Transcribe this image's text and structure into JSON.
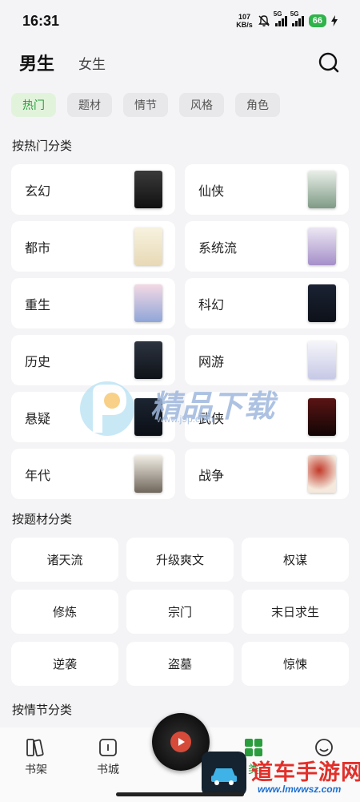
{
  "status": {
    "time": "16:31",
    "net_speed_value": "107",
    "net_speed_unit": "KB/s",
    "sig1_label": "5G",
    "sig2_label": "5G",
    "battery": "66"
  },
  "header": {
    "tab_male": "男生",
    "tab_female": "女生",
    "icons": [
      "search-icon"
    ]
  },
  "filters": [
    "热门",
    "题材",
    "情节",
    "风格",
    "角色"
  ],
  "section_hot": "按热门分类",
  "genres": [
    "玄幻",
    "仙侠",
    "都市",
    "系统流",
    "重生",
    "科幻",
    "历史",
    "网游",
    "悬疑",
    "武侠",
    "年代",
    "战争"
  ],
  "section_theme": "按题材分类",
  "themes": [
    "诸天流",
    "升级爽文",
    "权谋",
    "修炼",
    "宗门",
    "末日求生",
    "逆袭",
    "盗墓",
    "惊悚"
  ],
  "section_plot": "按情节分类",
  "nav": {
    "bookshelf": "书架",
    "bookcity": "书城",
    "category_partial": "类",
    "icons": [
      "bookshelf-icon",
      "bookcity-icon",
      "category-icon",
      "profile-icon",
      "play-icon"
    ]
  },
  "watermark": {
    "center_text": "精品下载",
    "center_url": "www.j9p.com",
    "corner_text": "道车手游网",
    "corner_url": "www.lmwwsz.com"
  },
  "colors": {
    "accent": "#2a9d3d",
    "chip_active_bg": "#e2f3dc",
    "battery": "#2fb34a"
  }
}
